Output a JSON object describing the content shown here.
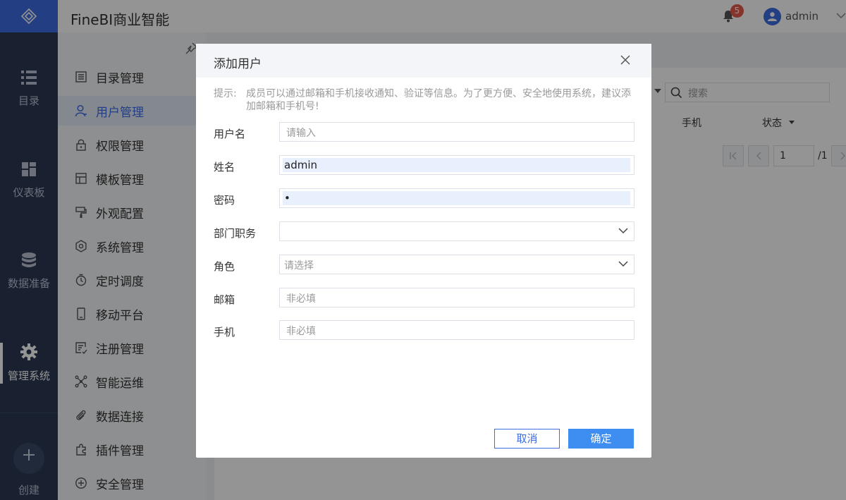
{
  "app": {
    "title": "FineBI商业智能"
  },
  "topbar": {
    "notification_count": "5",
    "user_name": "admin"
  },
  "navrail": {
    "items": [
      {
        "label": "目录",
        "icon": "list-icon"
      },
      {
        "label": "仪表板",
        "icon": "dashboard-icon"
      },
      {
        "label": "数据准备",
        "icon": "database-icon"
      },
      {
        "label": "管理系统",
        "icon": "gear-icon",
        "active": true
      }
    ],
    "create_label": "创建"
  },
  "sidebar": {
    "items": [
      {
        "label": "目录管理",
        "icon": "directory-icon"
      },
      {
        "label": "用户管理",
        "icon": "user-icon",
        "active": true
      },
      {
        "label": "权限管理",
        "icon": "lock-icon"
      },
      {
        "label": "模板管理",
        "icon": "template-icon"
      },
      {
        "label": "外观配置",
        "icon": "paint-icon"
      },
      {
        "label": "系统管理",
        "icon": "settings-icon"
      },
      {
        "label": "定时调度",
        "icon": "timer-icon"
      },
      {
        "label": "移动平台",
        "icon": "mobile-icon"
      },
      {
        "label": "注册管理",
        "icon": "register-icon"
      },
      {
        "label": "智能运维",
        "icon": "network-icon"
      },
      {
        "label": "数据连接",
        "icon": "link-icon"
      },
      {
        "label": "插件管理",
        "icon": "plugin-icon"
      },
      {
        "label": "安全管理",
        "icon": "shield-icon"
      }
    ]
  },
  "background_table": {
    "search_placeholder": "搜索",
    "columns": [
      "手机",
      "状态"
    ],
    "pager": {
      "current_page": "1",
      "total": "/1"
    }
  },
  "dialog": {
    "title": "添加用户",
    "tip_label": "提示:",
    "tip_text": "成员可以通过邮箱和手机接收通知、验证等信息。为了更方便、安全地使用系统，建议添加邮箱和手机号!",
    "fields": {
      "username": {
        "label": "用户名",
        "placeholder": "请输入",
        "value": ""
      },
      "realname": {
        "label": "姓名",
        "value": "admin"
      },
      "password": {
        "label": "密码",
        "value": "•"
      },
      "department": {
        "label": "部门职务",
        "value": ""
      },
      "role": {
        "label": "角色",
        "placeholder": "请选择"
      },
      "email": {
        "label": "邮箱",
        "placeholder": "非必填"
      },
      "phone": {
        "label": "手机",
        "placeholder": "非必填"
      }
    },
    "cancel_label": "取消",
    "ok_label": "确定"
  },
  "colors": {
    "accent": "#3d6ce0",
    "nav_bg": "#2b3a55",
    "primary_button": "#3d8ef0",
    "badge": "#e55a4b"
  }
}
